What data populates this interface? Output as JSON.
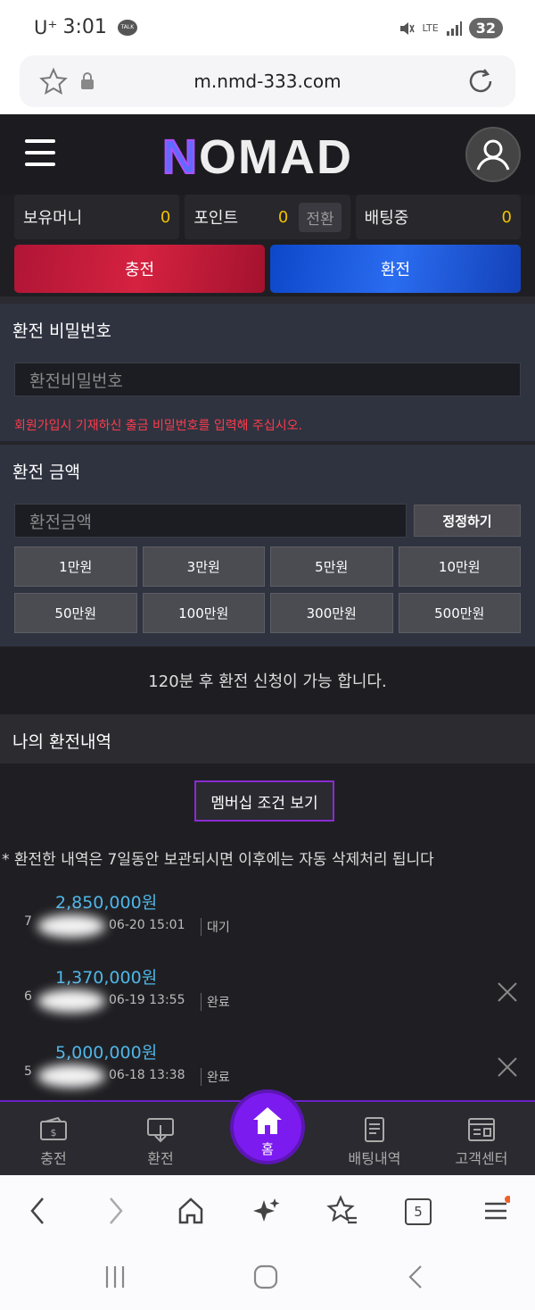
{
  "status_bar": {
    "carrier": "U⁺",
    "time": "3:01",
    "talk_badge": "TALK",
    "network": "LTE",
    "battery": "32"
  },
  "browser": {
    "url": "m.nmd-333.com",
    "tab_count": "5"
  },
  "header": {
    "logo_text": "NOMAD"
  },
  "balances": {
    "money_label": "보유머니",
    "money_value": "0",
    "point_label": "포인트",
    "point_value": "0",
    "convert_label": "전환",
    "betting_label": "배팅중",
    "betting_value": "0"
  },
  "actions": {
    "deposit": "충전",
    "withdraw": "환전"
  },
  "password_section": {
    "title": "환전 비밀번호",
    "placeholder": "환전비밀번호",
    "warning": "회원가입시 기재하신 출금 비밀번호를 입력해 주십시오."
  },
  "amount_section": {
    "title": "환전 금액",
    "placeholder": "환전금액",
    "confirm_label": "정정하기",
    "quick_amounts": [
      "1만원",
      "3만원",
      "5만원",
      "10만원",
      "50만원",
      "100만원",
      "300만원",
      "500만원"
    ]
  },
  "notice": "120분 후 환전 신청이 가능 합니다.",
  "history": {
    "title": "나의 환전내역",
    "membership_button": "멤버십 조건 보기",
    "note": "* 환전한 내역은 7일동안 보관되시면 이후에는 자동 삭제처리 됩니다",
    "rows": [
      {
        "num": "7",
        "amount": "2,850,000원",
        "date": "06-20 15:01",
        "status": "대기"
      },
      {
        "num": "6",
        "amount": "1,370,000원",
        "date": "06-19 13:55",
        "status": "완료"
      },
      {
        "num": "5",
        "amount": "5,000,000원",
        "date": "06-18 13:38",
        "status": "완료"
      }
    ]
  },
  "bottom_nav": {
    "deposit": "충전",
    "withdraw": "환전",
    "home": "홈",
    "bet_history": "배팅내역",
    "support": "고객센터"
  }
}
